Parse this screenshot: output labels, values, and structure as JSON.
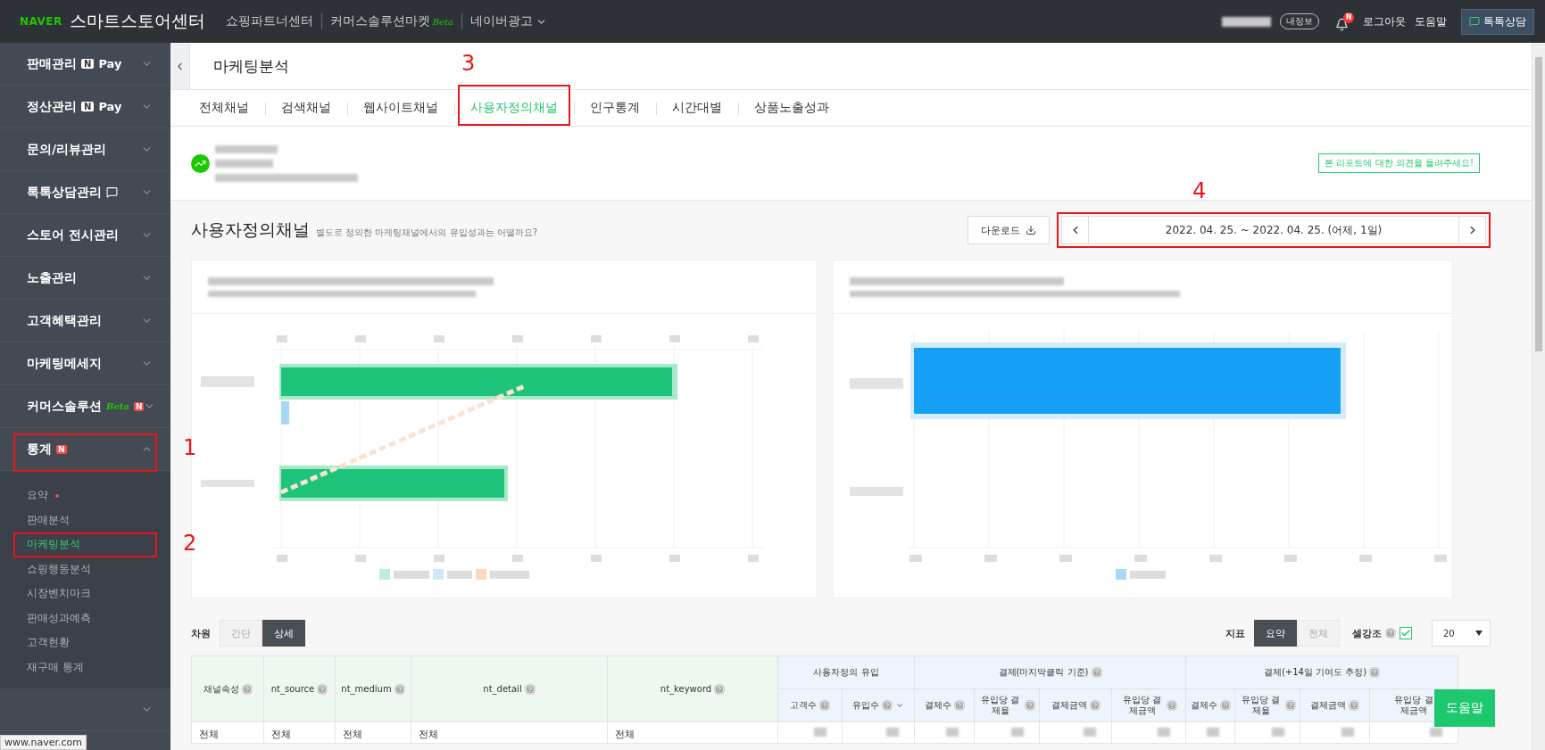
{
  "topbar": {
    "brand": "NAVER",
    "title": "스마트스토어센터",
    "links": [
      {
        "label": "쇼핑파트너센터"
      },
      {
        "label": "커머스솔루션마켓",
        "tag": "Beta"
      },
      {
        "label": "네이버광고",
        "dropdown": true
      }
    ],
    "my_info": "내정보",
    "notification_badge": "N",
    "logout": "로그아웃",
    "help": "도움말",
    "chat_button": "톡톡상담"
  },
  "sidebar": {
    "items": [
      {
        "label": "판매관리",
        "badges": [
          {
            "kind": "npay",
            "mark": "N",
            "text": "Pay"
          }
        ],
        "expanded": false
      },
      {
        "label": "정산관리",
        "badges": [
          {
            "kind": "npay",
            "mark": "N",
            "text": "Pay"
          }
        ],
        "expanded": false
      },
      {
        "label": "문의/리뷰관리",
        "expanded": false
      },
      {
        "label": "톡톡상담관리",
        "badges": [
          {
            "kind": "chat"
          }
        ],
        "expanded": false
      },
      {
        "label": "스토어 전시관리",
        "expanded": false
      },
      {
        "label": "노출관리",
        "expanded": false
      },
      {
        "label": "고객혜택관리",
        "expanded": false
      },
      {
        "label": "마케팅메세지",
        "expanded": false
      },
      {
        "label": "커머스솔루션",
        "badges": [
          {
            "kind": "beta",
            "text": "Beta"
          },
          {
            "kind": "new",
            "mark": "N"
          }
        ],
        "expanded": false
      },
      {
        "label": "통계",
        "badges": [
          {
            "kind": "new",
            "mark": "N"
          }
        ],
        "expanded": true,
        "callout": "1",
        "children": [
          {
            "label": "요약",
            "selected": false,
            "dot": true
          },
          {
            "label": "판매분석",
            "selected": false
          },
          {
            "label": "마케팅분석",
            "selected": true,
            "callout": "2"
          },
          {
            "label": "쇼핑행동분석",
            "selected": false
          },
          {
            "label": "시장벤치마크",
            "selected": false
          },
          {
            "label": "판매성과예측",
            "selected": false
          },
          {
            "label": "고객현황",
            "selected": false
          },
          {
            "label": "재구매 통계",
            "selected": false
          }
        ]
      },
      {
        "expanded": false
      }
    ]
  },
  "page_title": "마케팅분석",
  "tabs": [
    {
      "label": "전체채널",
      "selected": false
    },
    {
      "label": "검색채널",
      "selected": false
    },
    {
      "label": "웹사이트채널",
      "selected": false
    },
    {
      "label": "사용자정의채널",
      "selected": true,
      "callout": "3"
    },
    {
      "label": "인구통계",
      "selected": false
    },
    {
      "label": "시간대별",
      "selected": false
    },
    {
      "label": "상품노출성과",
      "selected": false
    }
  ],
  "feedback_link": "본 리포트에 대한 의견을 들려주세요!",
  "section": {
    "title": "사용자정의채널",
    "subtitle": "별도로 정의한 마케팅채널에서의 유입성과는 어떨까요?",
    "download": "다운로드",
    "date_range": {
      "text": "2022. 04. 25. ~ 2022. 04. 25. (어제, 1일)",
      "callout": "4"
    }
  },
  "charts": [
    {
      "kind": "multi_series"
    },
    {
      "kind": "single_series"
    }
  ],
  "controls": {
    "dimension_label": "차원",
    "dimension_options": [
      {
        "label": "간단",
        "selected": false
      },
      {
        "label": "상세",
        "selected": true
      }
    ],
    "metric_label": "지표",
    "metric_options": [
      {
        "label": "요약",
        "selected": true
      },
      {
        "label": "전체",
        "selected": false
      }
    ],
    "highlight_label": "셀강조",
    "highlight_checked": true,
    "page_size": "20"
  },
  "table": {
    "fixed_columns": [
      "채널속성",
      "nt_source",
      "nt_medium",
      "nt_detail",
      "nt_keyword"
    ],
    "groups": [
      {
        "label": "사용자정의 유입",
        "columns": [
          {
            "label": "고객수",
            "sorted": false
          },
          {
            "label": "유입수",
            "sorted": true
          }
        ]
      },
      {
        "label": "결제(마지막클릭 기준)",
        "columns": [
          {
            "label": "결제수",
            "sorted": false
          },
          {
            "label": "유입당 결제율",
            "sorted": false
          },
          {
            "label": "결제금액",
            "sorted": false
          },
          {
            "label": "유입당 결제금액",
            "sorted": false
          }
        ]
      },
      {
        "label": "결제(+14일 기여도 추정)",
        "columns": [
          {
            "label": "결제수",
            "sorted": false
          },
          {
            "label": "유입당 결제율",
            "sorted": false
          },
          {
            "label": "결제금액",
            "sorted": false
          },
          {
            "label": "유입당 결제금액",
            "sorted": false
          }
        ]
      }
    ],
    "rows": [
      {
        "cells": [
          "전체",
          "전체",
          "전체",
          "전체",
          "전체"
        ]
      }
    ]
  },
  "help_button": "도움말",
  "status_url": "www.naver.com"
}
